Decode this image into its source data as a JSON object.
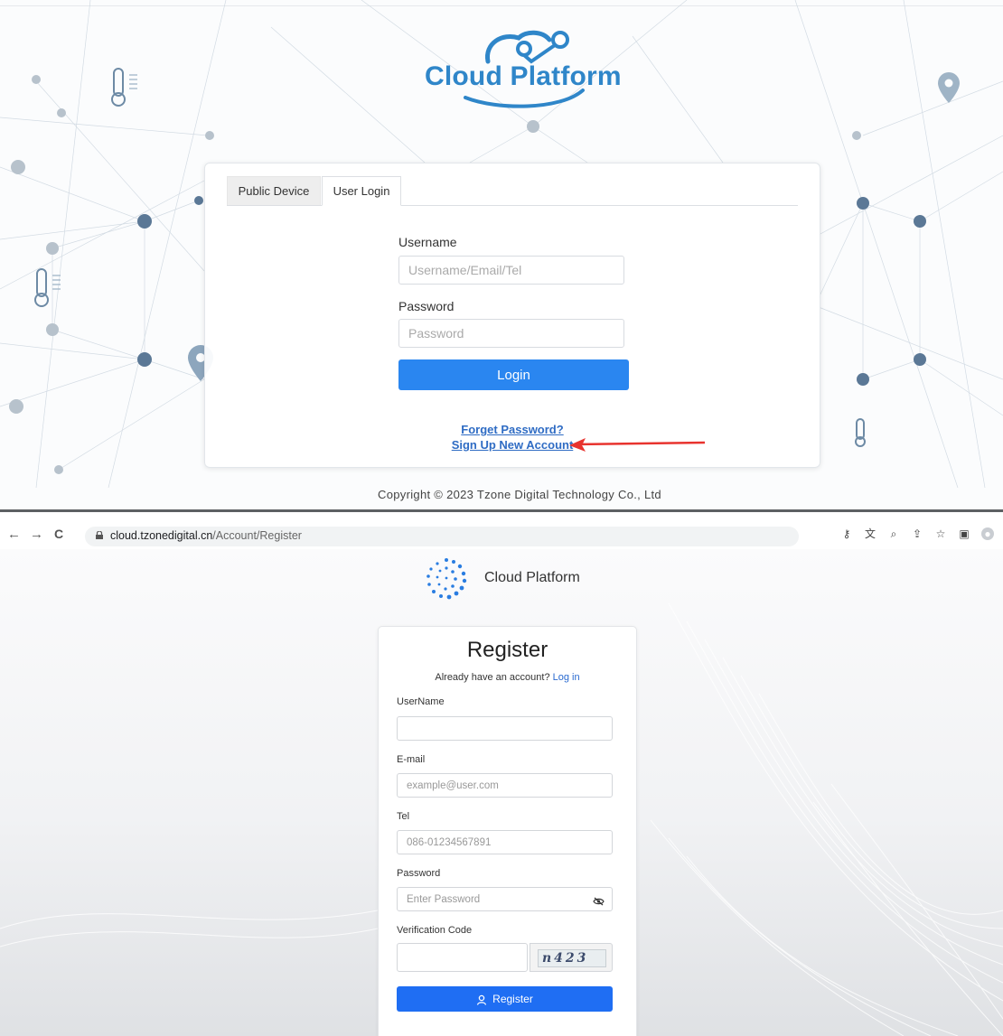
{
  "login_screen": {
    "logo_text": "Cloud Platform",
    "tabs": [
      {
        "label": "Public Device",
        "active": false
      },
      {
        "label": "User Login",
        "active": true
      }
    ],
    "username_label": "Username",
    "username_placeholder": "Username/Email/Tel",
    "password_label": "Password",
    "password_placeholder": "Password",
    "login_button": "Login",
    "forget_password_link": "Forget Password?",
    "sign_up_link": "Sign Up New Account",
    "copyright": "Copyright © 2023 Tzone Digital Technology Co., Ltd",
    "annotation_arrow_color": "#e8332e"
  },
  "browser": {
    "back_icon": "←",
    "forward_icon": "→",
    "reload_icon": "C",
    "url_domain": "cloud.tzonedigital.cn",
    "url_path": "/Account/Register",
    "toolbar_icons": [
      "key-icon",
      "translate-icon",
      "zoom-icon",
      "share-icon",
      "star-icon",
      "sidepanel-icon",
      "profile-icon"
    ]
  },
  "register_screen": {
    "brand": "Cloud Platform",
    "title": "Register",
    "subtitle_prefix": "Already have an account? ",
    "login_link": "Log in",
    "fields": {
      "username_label": "UserName",
      "username_value": "",
      "email_label": "E-mail",
      "email_placeholder": "example@user.com",
      "tel_label": "Tel",
      "tel_placeholder": "086-01234567891",
      "password_label": "Password",
      "password_placeholder": "Enter Password",
      "code_label": "Verification Code",
      "code_value": ""
    },
    "captcha_text": "n423",
    "register_button": "Register",
    "accent_color": "#1f6ef3"
  }
}
